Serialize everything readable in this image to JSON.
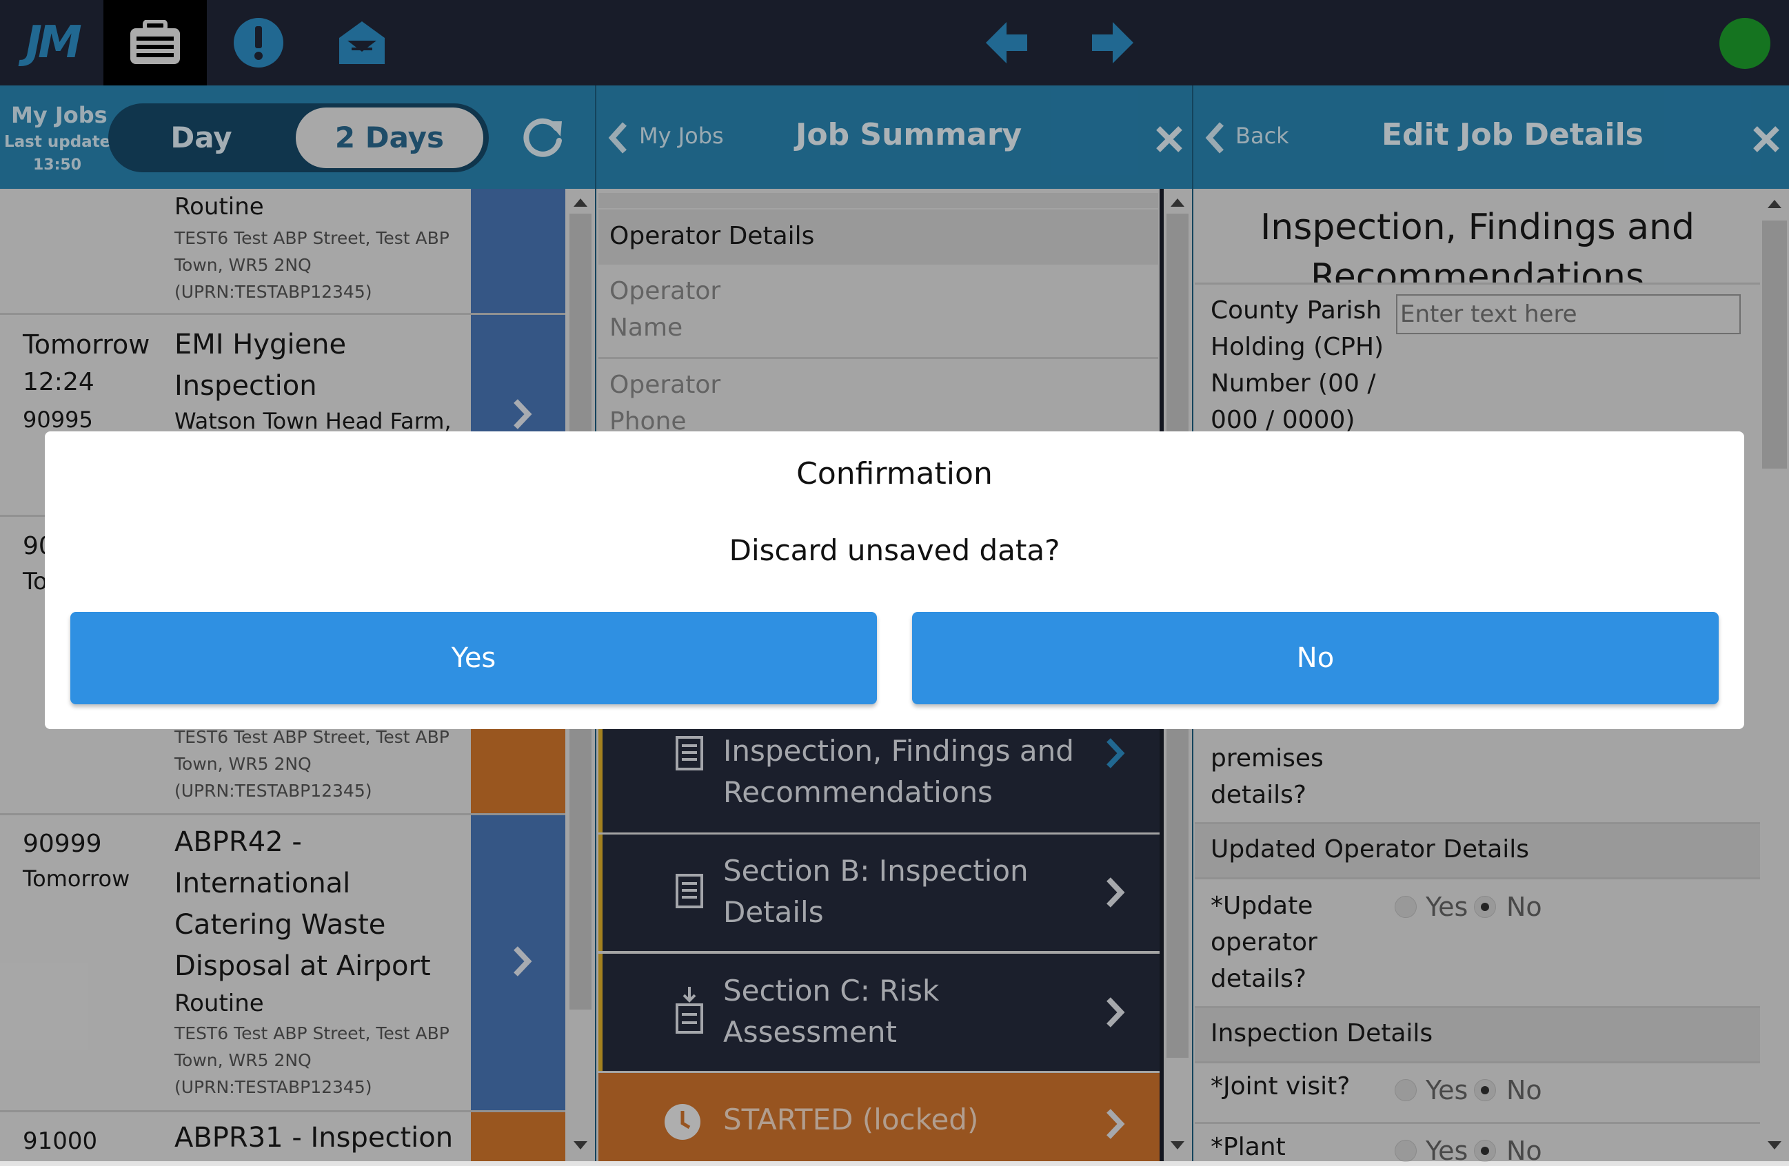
{
  "topbar": {
    "logo_text": "JM",
    "icons": [
      "jobs-icon",
      "alert-icon",
      "mail-icon"
    ],
    "status_color": "#1ea12d"
  },
  "panel1": {
    "title": "My Jobs",
    "last_updated_label": "Last updated",
    "last_updated_time": "13:50",
    "toggle": {
      "day": "Day",
      "two_days": "2 Days"
    }
  },
  "panel2": {
    "back_label": "My Jobs",
    "title": "Job Summary",
    "section_header": "Operator Details",
    "fields": [
      "Operator Name",
      "Operator Phone"
    ],
    "items": [
      {
        "label": "Inspection, Findings and Recommendations"
      },
      {
        "label": "Section B: Inspection Details"
      },
      {
        "label": "Section C: Risk Assessment"
      }
    ],
    "status": "STARTED (locked)"
  },
  "panel3": {
    "back_label": "Back",
    "title": "Edit Job Details",
    "section_title": "Inspection, Findings and Recommendations",
    "cph_label": "County Parish Holding (CPH) Number (00 / 000 / 0000)",
    "cph_placeholder": "Enter text here",
    "premises_label": "premises details?",
    "updated_operator_header": "Updated Operator Details",
    "update_operator_label": "*Update operator details?",
    "inspection_details_header": "Inspection Details",
    "joint_visit_label": "*Joint visit?",
    "plant_label": "*Plant",
    "yes": "Yes",
    "no": "No"
  },
  "jobs": [
    {
      "type": "Routine",
      "address": "TEST6 Test ABP Street, Test ABP Town, WR5 2NQ (UPRN:TESTABP12345)",
      "color": "#4a78b9"
    },
    {
      "when": "Tomorrow",
      "time": "12:24",
      "id": "90995",
      "title": "EMI Hygiene Inspection",
      "address": "Watson Town Head Farm,",
      "color": "#4a78b9"
    },
    {
      "id_partial": "90",
      "when_partial": "To",
      "address": "TEST6 Test ABP Street, Test ABP Town, WR5 2NQ (UPRN:TESTABP12345)",
      "color": "#d5782c"
    },
    {
      "id": "90999",
      "when": "Tomorrow",
      "title": "ABPR42 - International Catering Waste Disposal at Airport",
      "type": "Routine",
      "address": "TEST6 Test ABP Street, Test ABP Town, WR5 2NQ (UPRN:TESTABP12345)",
      "color": "#4a78b9"
    },
    {
      "id": "91000",
      "title": "ABPR31 - Inspection",
      "color": "#d5782c"
    }
  ],
  "modal": {
    "title": "Confirmation",
    "message": "Discard unsaved data?",
    "yes": "Yes",
    "no": "No",
    "button_color": "#2f90e2"
  }
}
